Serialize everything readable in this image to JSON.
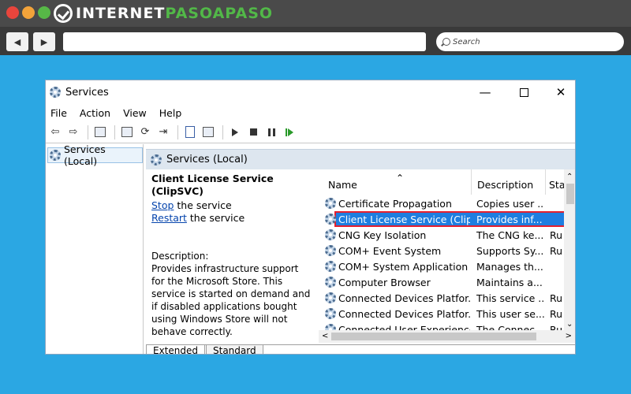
{
  "browser": {
    "logo_prefix": "INTERNET",
    "logo_accent": "PASOAPASO",
    "back_label": "◀",
    "forward_label": "▶",
    "search_placeholder": "Search"
  },
  "window": {
    "title": "Services",
    "controls": {
      "minimize": "—",
      "close": "✕"
    }
  },
  "menu": [
    "File",
    "Action",
    "View",
    "Help"
  ],
  "tree": {
    "item": "Services (Local)"
  },
  "pane": {
    "header": "Services (Local)",
    "selected_service": "Client License Service (ClipSVC)",
    "stop_link": "Stop",
    "stop_rest": " the service",
    "restart_link": "Restart",
    "restart_rest": " the service",
    "description_label": "Description:",
    "description_text": "Provides infrastructure support for the Microsoft Store. This service is started on demand and if disabled applications bought using Windows Store will not behave correctly."
  },
  "columns": {
    "name": "Name",
    "description": "Description",
    "status": "Sta"
  },
  "rows": [
    {
      "name": "Certificate Propagation",
      "description": "Copies user ...",
      "status": ""
    },
    {
      "name": "Client License Service (ClipS...",
      "description": "Provides inf...",
      "status": ""
    },
    {
      "name": "CNG Key Isolation",
      "description": "The CNG ke...",
      "status": "Ru"
    },
    {
      "name": "COM+ Event System",
      "description": "Supports Sy...",
      "status": "Ru"
    },
    {
      "name": "COM+ System Application",
      "description": "Manages th...",
      "status": ""
    },
    {
      "name": "Computer Browser",
      "description": "Maintains a...",
      "status": ""
    },
    {
      "name": "Connected Devices Platfor...",
      "description": "This service ...",
      "status": "Ru"
    },
    {
      "name": "Connected Devices Platfor...",
      "description": "This user se...",
      "status": "Ru"
    },
    {
      "name": "Connected User Experience...",
      "description": "The Connec...",
      "status": "Ru"
    }
  ],
  "selected_row_index": 1,
  "tabs": [
    "Extended",
    "Standard"
  ],
  "colors": {
    "background": "#2ba7e3",
    "selection": "#1e7ee0",
    "highlight_border": "#e4202f",
    "logo_accent": "#52b848"
  }
}
